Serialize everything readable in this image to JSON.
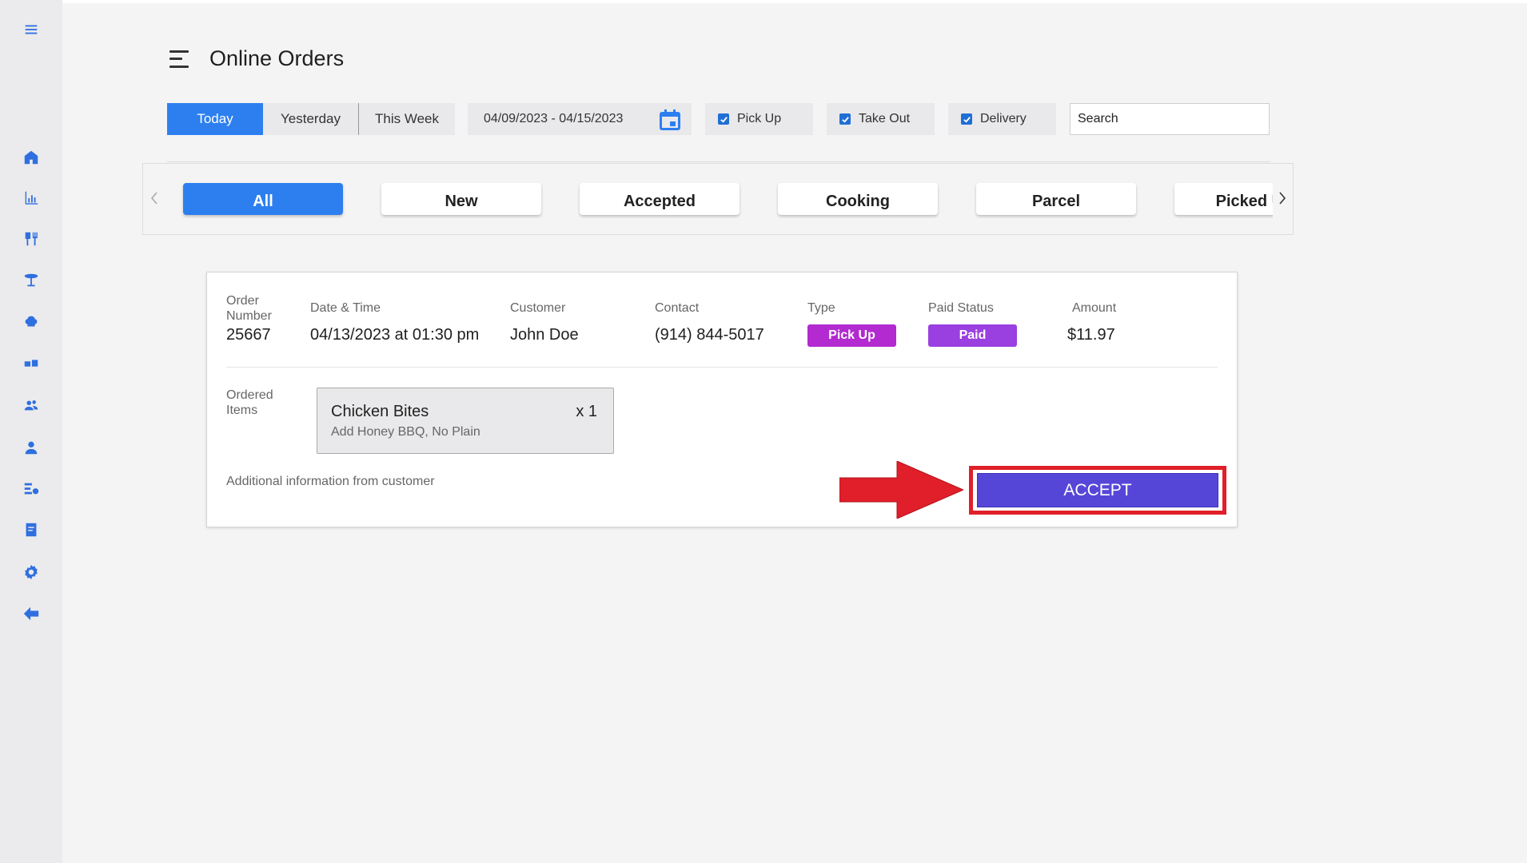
{
  "header": {
    "title": "Online Orders"
  },
  "sidebar": {
    "icons": [
      "menu-icon",
      "home-icon",
      "chart-icon",
      "restaurant-icon",
      "table-icon",
      "chef-hat-icon",
      "cards-icon",
      "customers-icon",
      "user-icon",
      "reports-icon",
      "invoice-icon",
      "settings-icon",
      "back-arrow-icon"
    ]
  },
  "filters": {
    "periods": [
      "Today",
      "Yesterday",
      "This Week"
    ],
    "active_period": "Today",
    "date_range": "04/09/2023 - 04/15/2023",
    "checkboxes": [
      {
        "label": "Pick Up",
        "checked": true
      },
      {
        "label": "Take Out",
        "checked": true
      },
      {
        "label": "Delivery",
        "checked": true
      }
    ],
    "search_placeholder": "Search"
  },
  "status_tabs": [
    "All",
    "New",
    "Accepted",
    "Cooking",
    "Parcel",
    "Picked Up"
  ],
  "active_status_tab": "All",
  "order": {
    "labels": {
      "order_number_line1": "Order",
      "order_number_line2": "Number",
      "date_time": "Date & Time",
      "customer": "Customer",
      "contact": "Contact",
      "type": "Type",
      "paid_status": "Paid Status",
      "amount": "Amount",
      "ordered_items_line1": "Ordered",
      "ordered_items_line2": "Items",
      "additional_info": "Additional information from customer"
    },
    "order_number": "25667",
    "date_time": "04/13/2023 at 01:30 pm",
    "customer": "John Doe",
    "contact": "(914) 844-5017",
    "type": "Pick Up",
    "paid_status": "Paid",
    "amount": "$11.97",
    "items": [
      {
        "name": "Chicken Bites",
        "qty": "x 1",
        "modifiers": "Add Honey BBQ, No Plain"
      }
    ],
    "accept_label": "ACCEPT"
  },
  "colors": {
    "primary": "#2d7ff0",
    "type_badge": "#b22ad0",
    "paid_badge": "#9a3fe0",
    "accept": "#5646d8",
    "highlight": "#e01f2a"
  }
}
